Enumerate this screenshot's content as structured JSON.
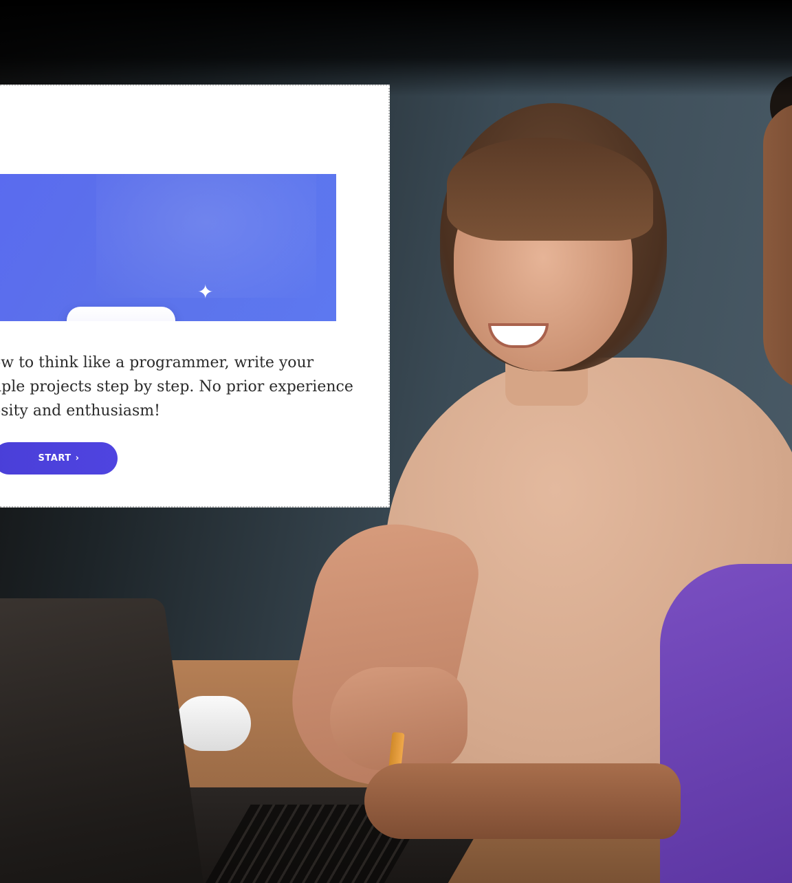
{
  "dialog": {
    "description_lines": [
      "ow to think like a programmer, write your",
      "nple projects step by step. No prior experience",
      "osity and enthusiasm!"
    ],
    "start_button": {
      "label": "START",
      "chevron": "›"
    },
    "banner": {
      "icon": "code-brackets-icon",
      "sparkle": "✦",
      "color": "#5b6ff0"
    }
  },
  "colors": {
    "accent": "#4c42dd",
    "banner": "#5b6ff0",
    "card_background": "#ffffff",
    "text": "#2b2b2b"
  }
}
